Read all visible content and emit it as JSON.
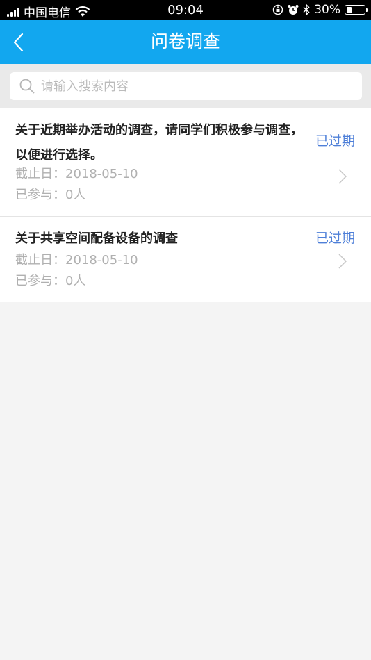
{
  "status_bar": {
    "carrier": "中国电信",
    "time": "09:04",
    "battery_percent": "30%",
    "battery_level": 0.3,
    "icons": [
      "signal-icon",
      "wifi-icon",
      "rotation-lock-icon",
      "alarm-icon",
      "bluetooth-icon",
      "battery-icon"
    ]
  },
  "header": {
    "title": "问卷调查",
    "back_icon": "chevron-left-icon",
    "bar_color": "#12a7ef"
  },
  "search": {
    "placeholder": "请输入搜索内容",
    "value": "",
    "icon": "search-icon"
  },
  "surveys": [
    {
      "title": "关于近期举办活动的调查，请同学们积极参与调查，以便进行选择。",
      "deadline": "截止日：2018-05-10",
      "participants": "已参与：0人",
      "status": "已过期"
    },
    {
      "title": "关于共享空间配备设备的调查",
      "deadline": "截止日：2018-05-10",
      "participants": "已参与：0人",
      "status": "已过期"
    }
  ],
  "colors": {
    "status_expired": "#4e7fd8",
    "page_background": "#f4f4f4"
  }
}
